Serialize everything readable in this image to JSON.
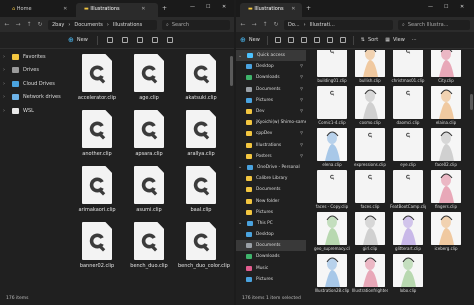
{
  "left_window": {
    "tabs": [
      {
        "label": "Home",
        "active": false
      },
      {
        "label": "Illustrations",
        "active": true
      }
    ],
    "breadcrumbs": [
      "2bay",
      "Documents",
      "Illustrations"
    ],
    "search_placeholder": "Search",
    "new_label": "New",
    "sidebar": [
      {
        "label": "Favorites",
        "icon": "star-icon",
        "color": "#f3c640"
      },
      {
        "label": "Drives",
        "icon": "drive-icon",
        "color": "#9a9a9a"
      },
      {
        "label": "Cloud Drives",
        "icon": "cloud-icon",
        "color": "#4aa3df"
      },
      {
        "label": "Network drives",
        "icon": "network-icon",
        "color": "#6db3e8"
      },
      {
        "label": "WSL",
        "icon": "linux-icon",
        "color": "#e8e8e8"
      }
    ],
    "files": [
      "accelerator.clip",
      "age.clip",
      "akatsuki.clip",
      "another.clip",
      "apsara.clip",
      "arallya.clip",
      "arimakaori.clip",
      "asumi.clip",
      "baal.clip",
      "banner02.clip",
      "bench_duo.clip",
      "bench_duo_color.clip"
    ],
    "status": "176 items"
  },
  "right_window": {
    "tab": {
      "label": "Illustrations"
    },
    "breadcrumbs": [
      "Do...",
      "Illustrati..."
    ],
    "search_placeholder": "Search Illustra...",
    "new_label": "New",
    "sort_label": "Sort",
    "view_label": "View",
    "sidebar": [
      {
        "label": "Quick access",
        "icon": "star-icon",
        "color": "#4cc2ff",
        "level": 0,
        "selected": true
      },
      {
        "label": "Desktop",
        "icon": "desktop-icon",
        "color": "#4aa3df",
        "level": 1
      },
      {
        "label": "Downloads",
        "icon": "download-icon",
        "color": "#3fb36b",
        "level": 1
      },
      {
        "label": "Documents",
        "icon": "documents-icon",
        "color": "#9aa0a6",
        "level": 1
      },
      {
        "label": "Pictures",
        "icon": "pictures-icon",
        "color": "#4aa3df",
        "level": 1
      },
      {
        "label": "Dev",
        "icon": "folder-icon",
        "color": "#f3c640",
        "level": 1
      },
      {
        "label": "jKyoichi(w) Shimo-same",
        "icon": "folder-icon",
        "color": "#f3c640",
        "level": 1
      },
      {
        "label": "cppDev",
        "icon": "folder-icon",
        "color": "#f3c640",
        "level": 1
      },
      {
        "label": "Illustrations",
        "icon": "folder-icon",
        "color": "#f3c640",
        "level": 1
      },
      {
        "label": "Posters",
        "icon": "folder-icon",
        "color": "#f3c640",
        "level": 1
      },
      {
        "label": "OneDrive - Personal",
        "icon": "onedrive-icon",
        "color": "#4aa3df",
        "level": 0
      },
      {
        "label": "Calibre Library",
        "icon": "folder-icon",
        "color": "#f3c640",
        "level": 1
      },
      {
        "label": "Documents",
        "icon": "folder-icon",
        "color": "#f3c640",
        "level": 1
      },
      {
        "label": "New folder",
        "icon": "folder-icon",
        "color": "#f3c640",
        "level": 1
      },
      {
        "label": "Pictures",
        "icon": "folder-icon",
        "color": "#f3c640",
        "level": 1
      },
      {
        "label": "This PC",
        "icon": "pc-icon",
        "color": "#4aa3df",
        "level": 0
      },
      {
        "label": "Desktop",
        "icon": "desktop-icon",
        "color": "#4aa3df",
        "level": 1
      },
      {
        "label": "Documents",
        "icon": "documents-icon",
        "color": "#9aa0a6",
        "level": 1,
        "selected": true
      },
      {
        "label": "Downloads",
        "icon": "download-icon",
        "color": "#3fb36b",
        "level": 1
      },
      {
        "label": "Music",
        "icon": "music-icon",
        "color": "#e35d8f",
        "level": 1
      },
      {
        "label": "Pictures",
        "icon": "pictures-icon",
        "color": "#4aa3df",
        "level": 1
      }
    ],
    "thumbnails": [
      {
        "label": "building01.clip",
        "kind": "clip"
      },
      {
        "label": "bullish.clip",
        "kind": "art"
      },
      {
        "label": "christmas01.clip",
        "kind": "clip"
      },
      {
        "label": "City.clip",
        "kind": "art"
      },
      {
        "label": "Comic1-4.clip",
        "kind": "clip"
      },
      {
        "label": "cosmo.clip",
        "kind": "art"
      },
      {
        "label": "daomci.clip",
        "kind": "clip"
      },
      {
        "label": "elaina.clip",
        "kind": "art"
      },
      {
        "label": "elena.clip",
        "kind": "art"
      },
      {
        "label": "expressions.clip",
        "kind": "clip"
      },
      {
        "label": "eye.clip",
        "kind": "clip"
      },
      {
        "label": "face02.clip",
        "kind": "art"
      },
      {
        "label": "faces - Copy.clip",
        "kind": "clip"
      },
      {
        "label": "faces.clip",
        "kind": "clip"
      },
      {
        "label": "FeatBootCamp.clip",
        "kind": "clip"
      },
      {
        "label": "fingers.clip",
        "kind": "art"
      },
      {
        "label": "geo_supremacy.clip",
        "kind": "art"
      },
      {
        "label": "girl.clip",
        "kind": "art"
      },
      {
        "label": "glitterart.clip",
        "kind": "art"
      },
      {
        "label": "iceberg.clip",
        "kind": "art"
      },
      {
        "label": "Illustration28.clip",
        "kind": "art"
      },
      {
        "label": "Illustrationfrighted...",
        "kind": "art"
      },
      {
        "label": "lobo.clip",
        "kind": "art"
      }
    ],
    "status": "176 items  1 item selected"
  },
  "colors": {
    "accent": "#4cc2ff",
    "bg": "#202020"
  }
}
